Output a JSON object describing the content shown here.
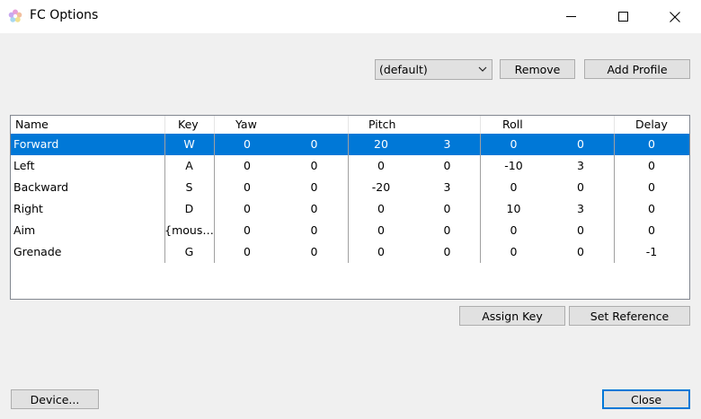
{
  "window": {
    "title": "FC Options",
    "icon": "flower-icon",
    "controls": [
      "minimize-icon",
      "maximize-icon",
      "close-icon"
    ]
  },
  "profile": {
    "selected": "(default)",
    "remove_label": "Remove",
    "add_label": "Add Profile"
  },
  "table": {
    "headers": [
      "Name",
      "Key",
      "Yaw",
      "Pitch",
      "Roll",
      "Delay"
    ],
    "rows": [
      {
        "name": "Forward",
        "key": "W",
        "yaw1": "0",
        "yaw2": "0",
        "pitch1": "20",
        "pitch2": "3",
        "roll1": "0",
        "roll2": "0",
        "delay": "0",
        "selected": true
      },
      {
        "name": "Left",
        "key": "A",
        "yaw1": "0",
        "yaw2": "0",
        "pitch1": "0",
        "pitch2": "0",
        "roll1": "-10",
        "roll2": "3",
        "delay": "0",
        "selected": false
      },
      {
        "name": "Backward",
        "key": "S",
        "yaw1": "0",
        "yaw2": "0",
        "pitch1": "-20",
        "pitch2": "3",
        "roll1": "0",
        "roll2": "0",
        "delay": "0",
        "selected": false
      },
      {
        "name": "Right",
        "key": "D",
        "yaw1": "0",
        "yaw2": "0",
        "pitch1": "0",
        "pitch2": "0",
        "roll1": "10",
        "roll2": "3",
        "delay": "0",
        "selected": false
      },
      {
        "name": "Aim",
        "key": "{mous…",
        "yaw1": "0",
        "yaw2": "0",
        "pitch1": "0",
        "pitch2": "0",
        "roll1": "0",
        "roll2": "0",
        "delay": "0",
        "selected": false
      },
      {
        "name": "Grenade",
        "key": "G",
        "yaw1": "0",
        "yaw2": "0",
        "pitch1": "0",
        "pitch2": "0",
        "roll1": "0",
        "roll2": "0",
        "delay": "-1",
        "selected": false
      }
    ]
  },
  "actions": {
    "assign_key": "Assign Key",
    "set_reference": "Set Reference",
    "device": "Device...",
    "close": "Close"
  },
  "colors": {
    "selection": "#0078d7",
    "default_button_border": "#0078d7"
  }
}
